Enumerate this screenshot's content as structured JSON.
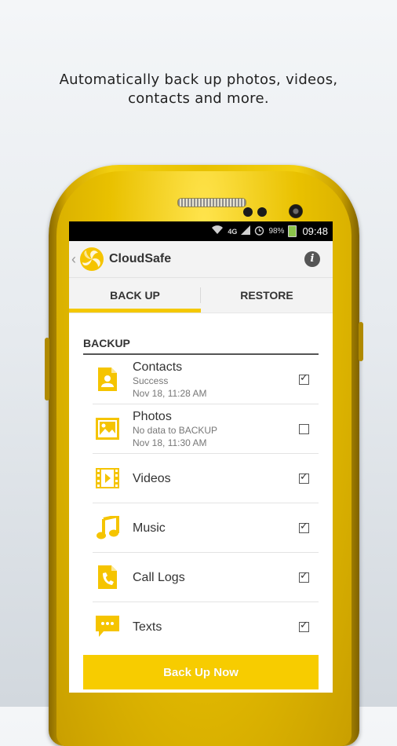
{
  "headline": {
    "line1": "Automatically back up photos, videos,",
    "line2": "contacts and more."
  },
  "statusbar": {
    "network": "4G",
    "battery_percent": "98%",
    "time": "09:48",
    "icons": [
      "wifi-icon",
      "signal-icon",
      "alarm-icon",
      "battery-icon"
    ]
  },
  "app": {
    "title": "CloudSafe",
    "logo": "cloudsafe-logo",
    "info_icon": "info-icon"
  },
  "tabs": [
    {
      "label": "BACK UP",
      "active": true
    },
    {
      "label": "RESTORE",
      "active": false
    }
  ],
  "backup": {
    "section_title": "BACKUP",
    "items": [
      {
        "label": "Contacts",
        "status": "Success",
        "date": "Nov 18, 11:28 AM",
        "checked": true,
        "icon": "contacts-icon"
      },
      {
        "label": "Photos",
        "status": "No data to BACKUP",
        "date": "Nov 18, 11:30 AM",
        "checked": false,
        "icon": "photos-icon"
      },
      {
        "label": "Videos",
        "checked": true,
        "icon": "videos-icon"
      },
      {
        "label": "Music",
        "checked": true,
        "icon": "music-icon"
      },
      {
        "label": "Call Logs",
        "checked": true,
        "icon": "call-logs-icon"
      },
      {
        "label": "Texts",
        "checked": true,
        "icon": "texts-icon"
      }
    ],
    "button_label": "Back Up Now"
  },
  "colors": {
    "accent": "#f4c800",
    "icon_yellow": "#f5c400",
    "phone_gold": "#e8c100"
  }
}
